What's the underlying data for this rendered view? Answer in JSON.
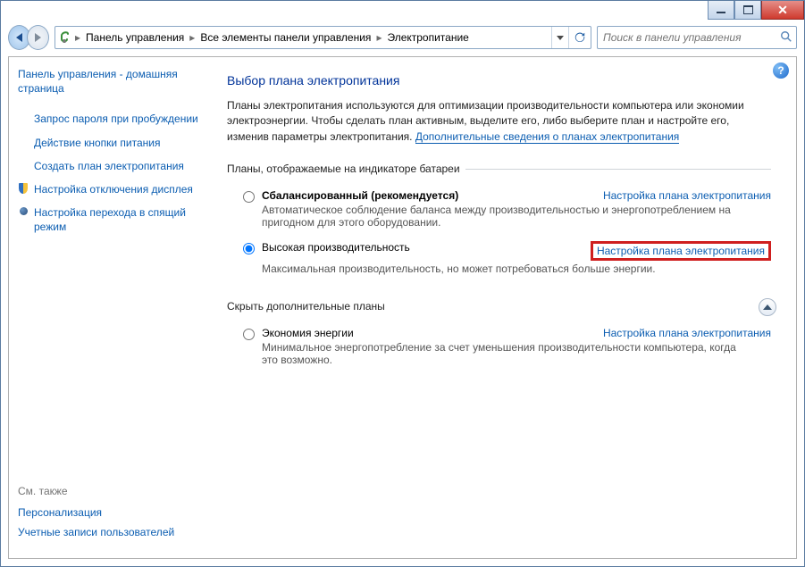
{
  "window": {
    "min_tip": "Свернуть",
    "max_tip": "Развернуть",
    "close_tip": "Закрыть"
  },
  "breadcrumbs": [
    "Панель управления",
    "Все элементы панели управления",
    "Электропитание"
  ],
  "search": {
    "placeholder": "Поиск в панели управления"
  },
  "sidebar": {
    "home": "Панель управления - домашняя страница",
    "items": [
      "Запрос пароля при пробуждении",
      "Действие кнопки питания",
      "Создать план электропитания",
      "Настройка отключения дисплея",
      "Настройка перехода в спящий режим"
    ],
    "seealso_hdr": "См. также",
    "seealso": [
      "Персонализация",
      "Учетные записи пользователей"
    ]
  },
  "main": {
    "heading": "Выбор плана электропитания",
    "intro_pref": "Планы электропитания используются для оптимизации производительности компьютера или экономии электроэнергии. Чтобы сделать план активным, выделите его, либо выберите план и настройте его, изменив параметры электропитания. ",
    "intro_link": "Дополнительные сведения о планах электропитания",
    "group1_legend": "Планы, отображаемые на индикаторе батареи",
    "group2_legend": "Скрыть дополнительные планы",
    "change_link": "Настройка плана электропитания",
    "plans_a": [
      {
        "title": "Сбалансированный (рекомендуется)",
        "desc": "Автоматическое соблюдение баланса между производительностью и энергопотреблением на пригодном для этого оборудовании.",
        "sel": false,
        "bold": true
      },
      {
        "title": "Высокая производительность",
        "desc": "Максимальная производительность, но может потребоваться больше энергии.",
        "sel": true,
        "bold": false,
        "hi": true
      }
    ],
    "plans_b": [
      {
        "title": "Экономия энергии",
        "desc": "Минимальное энергопотребление за счет уменьшения производительности компьютера, когда это возможно.",
        "sel": false
      }
    ]
  }
}
